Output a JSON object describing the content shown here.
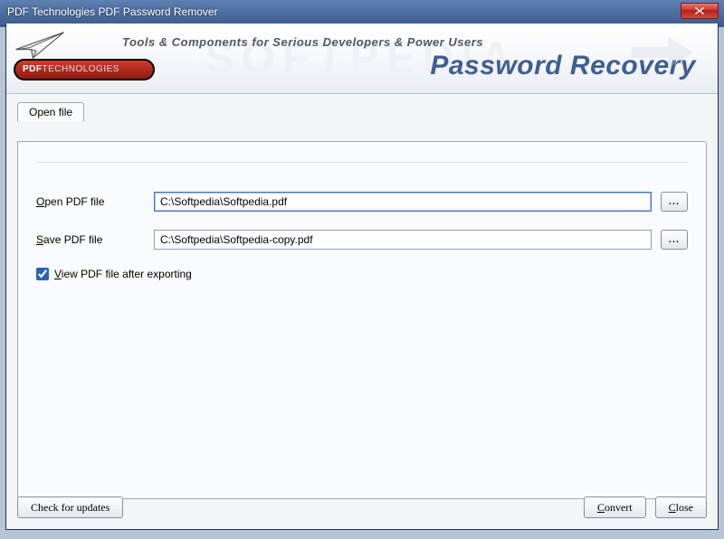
{
  "window": {
    "title": "PDF Technologies PDF Password Remover",
    "close_icon": "close"
  },
  "banner": {
    "watermark": "SOFTPEDIA",
    "tagline": "Tools & Components for Serious Developers & Power Users",
    "product_title": "Password Recovery",
    "logo_text_prefix": "PDF",
    "logo_text_suffix": "TECHNOLOGIES"
  },
  "tabs": {
    "active": "Open file"
  },
  "form": {
    "open_label_pre": "O",
    "open_label_rest": "pen PDF file",
    "open_value": "C:\\Softpedia\\Softpedia.pdf",
    "save_label_pre": "S",
    "save_label_rest": "ave PDF file",
    "save_value": "C:\\Softpedia\\Softpedia-copy.pdf",
    "browse_label": "...",
    "view_checked": true,
    "view_label_pre": "V",
    "view_label_rest": "iew PDF file after exporting"
  },
  "footer": {
    "updates_label": "Check for updates",
    "convert_pre": "C",
    "convert_rest": "onvert",
    "close_pre": "C",
    "close_rest": "lose"
  }
}
